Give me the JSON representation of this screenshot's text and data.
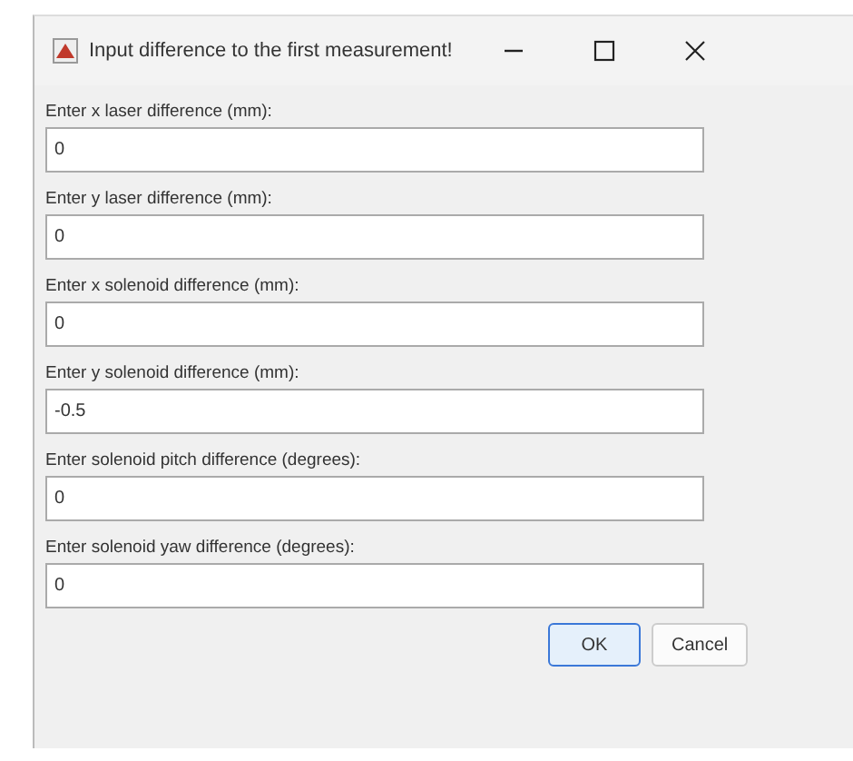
{
  "window": {
    "title": "Input difference to the first measurement!"
  },
  "fields": [
    {
      "label": "Enter x laser difference (mm):",
      "value": "0"
    },
    {
      "label": "Enter y laser difference (mm):",
      "value": "0"
    },
    {
      "label": "Enter x solenoid difference (mm):",
      "value": "0"
    },
    {
      "label": "Enter y solenoid difference (mm):",
      "value": "-0.5"
    },
    {
      "label": "Enter solenoid pitch difference (degrees):",
      "value": "0"
    },
    {
      "label": "Enter solenoid yaw difference (degrees):",
      "value": "0"
    }
  ],
  "buttons": [
    {
      "label": "OK",
      "default": true
    },
    {
      "label": "Cancel",
      "default": false
    }
  ]
}
